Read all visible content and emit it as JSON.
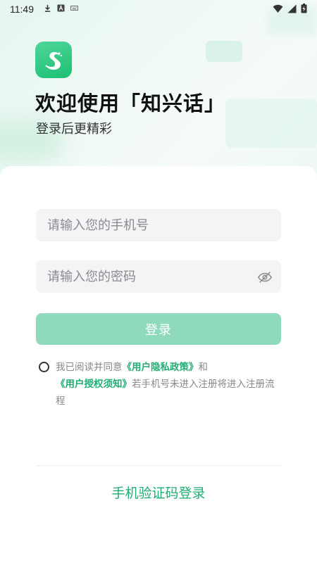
{
  "status_bar": {
    "time": "11:49"
  },
  "header": {
    "title": "欢迎使用「知兴话」",
    "subtitle": "登录后更精彩"
  },
  "form": {
    "phone_placeholder": "请输入您的手机号",
    "password_placeholder": "请输入您的密码",
    "login_label": "登录"
  },
  "agreement": {
    "prefix": "我已阅读并同意",
    "privacy_link": "《用户隐私政策》",
    "and": "和",
    "terms_link": "《用户授权须知》",
    "suffix": "若手机号未进入注册将进入注册流程"
  },
  "footer": {
    "sms_login_label": "手机验证码登录"
  },
  "colors": {
    "accent": "#1fae73",
    "button_disabled": "#8fd9bd",
    "logo": "#2cc47e"
  }
}
